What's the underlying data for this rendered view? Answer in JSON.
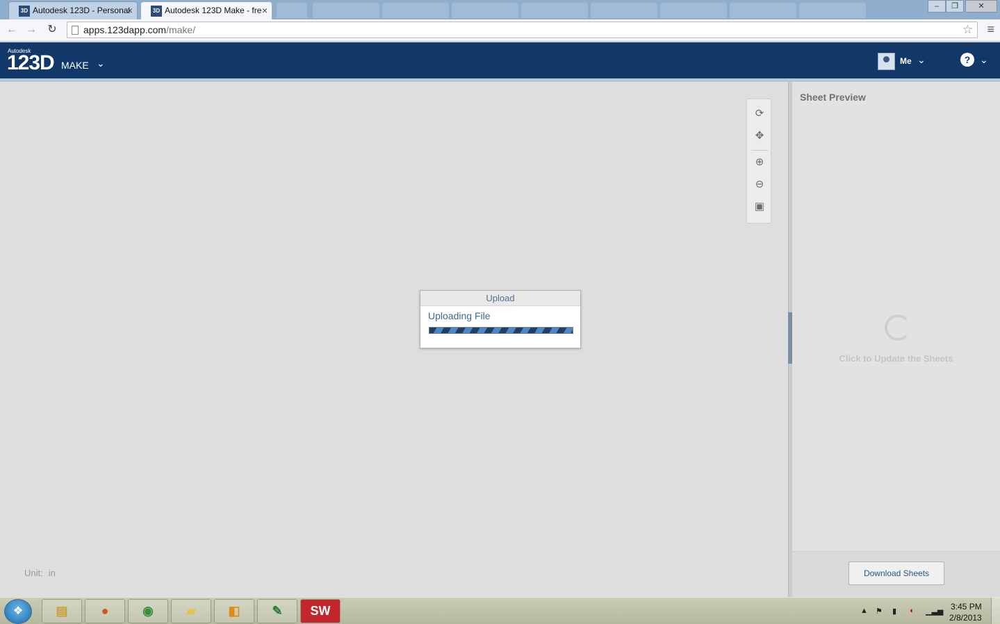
{
  "browser": {
    "tabs": [
      {
        "title": "Autodesk 123D - Personal",
        "favicon": "3D"
      },
      {
        "title": "Autodesk 123D Make - fre",
        "favicon": "3D"
      }
    ],
    "url_domain": "apps.123dapp.com",
    "url_path": "/make/"
  },
  "app": {
    "brand_small": "Autodesk",
    "brand_big": "123D",
    "product": "MAKE",
    "user_label": "Me",
    "help_glyph": "?"
  },
  "canvas": {
    "unit_label": "Unit:",
    "unit_value": "in",
    "tools": [
      "orbit-icon",
      "pan-icon",
      "zoom-in-icon",
      "zoom-out-icon",
      "fit-view-icon"
    ]
  },
  "upload_dialog": {
    "title": "Upload",
    "message": "Uploading File",
    "progress": "indeterminate"
  },
  "sheet_panel": {
    "title": "Sheet Preview",
    "update_label": "Click to Update the Sheets",
    "download_button": "Download Sheets"
  },
  "taskbar": {
    "apps": [
      "explorer",
      "firefox",
      "chrome",
      "folder",
      "outlook",
      "editor",
      "solidworks"
    ],
    "solidworks_label": "SW",
    "time": "3:45 PM",
    "date": "2/8/2013"
  },
  "colors": {
    "header_blue": "#12386a",
    "progress_dark": "#1f3f63",
    "progress_light": "#4f86c6"
  }
}
